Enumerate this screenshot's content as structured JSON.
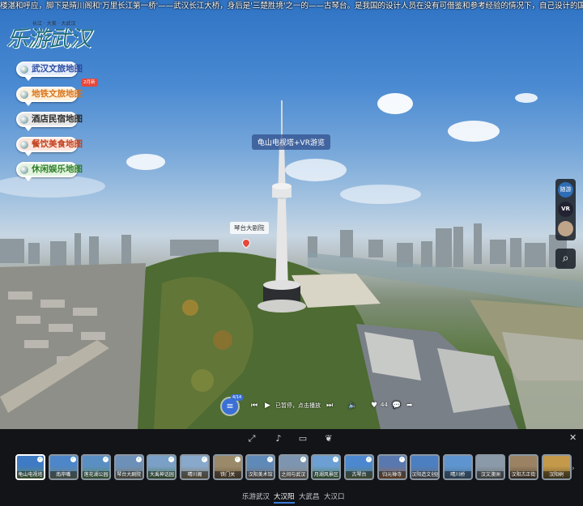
{
  "marquee": "楼湛和呼应，脚下是晴川阁和'万里长江第一桥'——武汉长江大桥，身后是'三楚胜境'之一的——古琴台。是我国的设计人员在没有可借鉴和参考经验的情况下，自己设计的国内第一台电视塔，是一个集发射传输、观光旅游等多功能",
  "brand": {
    "title": "乐游武汉",
    "subtitle": "长江 · 大美 · 大武汉"
  },
  "map_buttons": [
    {
      "label": "武汉文旅地图"
    },
    {
      "label": "地铁文旅地图"
    },
    {
      "label": "酒店民宿地图"
    },
    {
      "label": "餐饮美食地图"
    },
    {
      "label": "休闲娱乐地图"
    }
  ],
  "new_badge": "2月新",
  "hotspots": {
    "tower": "龟山电视塔+VR游览",
    "theatre": "琴台大剧院"
  },
  "right_tools": {
    "icon1": "随游",
    "vr": "VR"
  },
  "player": {
    "count": "4/14",
    "status": "已暂停，点击播放",
    "likes": "44"
  },
  "thumbnails": [
    {
      "label": "龟山电视塔",
      "checked": true,
      "active": true,
      "c1": "#3f7ac4",
      "c2": "#6a8f50"
    },
    {
      "label": "南岸嘴",
      "checked": true,
      "active": false,
      "c1": "#4d86c9",
      "c2": "#7a8470"
    },
    {
      "label": "莲花湖公园",
      "checked": true,
      "active": false,
      "c1": "#5a8fc4",
      "c2": "#5e8a52"
    },
    {
      "label": "琴台大剧院",
      "checked": true,
      "active": false,
      "c1": "#6d90b8",
      "c2": "#7d7a66"
    },
    {
      "label": "大禹神话园",
      "checked": true,
      "active": false,
      "c1": "#7aa0c8",
      "c2": "#4f7a48"
    },
    {
      "label": "晴川阁",
      "checked": true,
      "active": false,
      "c1": "#88a9cc",
      "c2": "#8a7a5a"
    },
    {
      "label": "铁门关",
      "checked": true,
      "active": false,
      "c1": "#9b8a6a",
      "c2": "#6e5a40"
    },
    {
      "label": "汉阳美术馆",
      "checked": true,
      "active": false,
      "c1": "#5f8ab8",
      "c2": "#7a6e62"
    },
    {
      "label": "之间与武汉",
      "checked": true,
      "active": false,
      "c1": "#7d95b0",
      "c2": "#8e8474"
    },
    {
      "label": "月湖风景区",
      "checked": true,
      "active": false,
      "c1": "#6c9fd4",
      "c2": "#55804a"
    },
    {
      "label": "古琴台",
      "checked": true,
      "active": false,
      "c1": "#4b88d0",
      "c2": "#70804c"
    },
    {
      "label": "归元禅寺",
      "checked": true,
      "active": false,
      "c1": "#5a78b0",
      "c2": "#a06a3a"
    },
    {
      "label": "汉阳造文创园",
      "checked": false,
      "active": false,
      "c1": "#4c7fc2",
      "c2": "#6a6a6a"
    },
    {
      "label": "晴川桥",
      "checked": false,
      "active": false,
      "c1": "#5e95d0",
      "c2": "#4e6f8a"
    },
    {
      "label": "汉文澳洲",
      "checked": false,
      "active": false,
      "c1": "#8a9aa8",
      "c2": "#6b6f70"
    },
    {
      "label": "汉阳古正街",
      "checked": false,
      "active": false,
      "c1": "#9a8262",
      "c2": "#5b4a3a"
    },
    {
      "label": "汉阳树",
      "checked": false,
      "active": false,
      "c1": "#c49a4a",
      "c2": "#6b5a30"
    }
  ],
  "categories": [
    {
      "label": "乐游武汉",
      "active": false
    },
    {
      "label": "大汉阳",
      "active": true
    },
    {
      "label": "大武昌",
      "active": false
    },
    {
      "label": "大汉口",
      "active": false
    }
  ]
}
